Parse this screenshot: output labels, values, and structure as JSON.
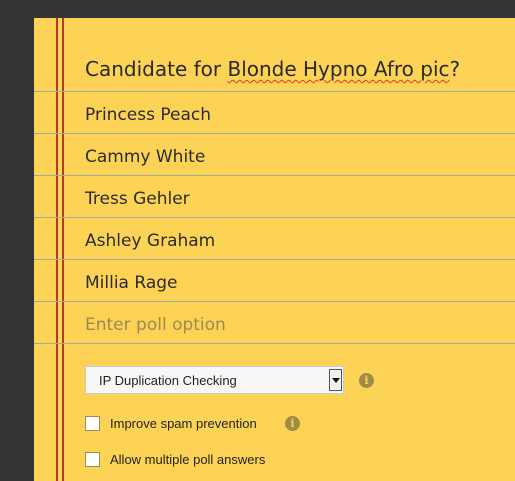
{
  "poll": {
    "question": "Candidate for Blonde Hypno Afro pic?",
    "question_plain": "Candidate for ",
    "question_misspelled": "Blonde Hypno Afro pic",
    "question_end": "?",
    "options": [
      "Princess Peach",
      "Cammy White",
      "Tress Gehler",
      "Ashley Graham",
      "Millia Rage"
    ],
    "new_option_placeholder": "Enter poll option"
  },
  "settings": {
    "duplication_select": {
      "selected": "IP Duplication Checking"
    },
    "spam_prevention_label": "Improve spam prevention",
    "spam_prevention_checked": false,
    "multiple_answers_label": "Allow multiple poll answers",
    "multiple_answers_checked": false,
    "info_glyph": "i"
  },
  "colors": {
    "paper": "#fdd355",
    "margin_line": "#b23a2a",
    "rule_line": "#9aaea0",
    "background": "#333333"
  }
}
